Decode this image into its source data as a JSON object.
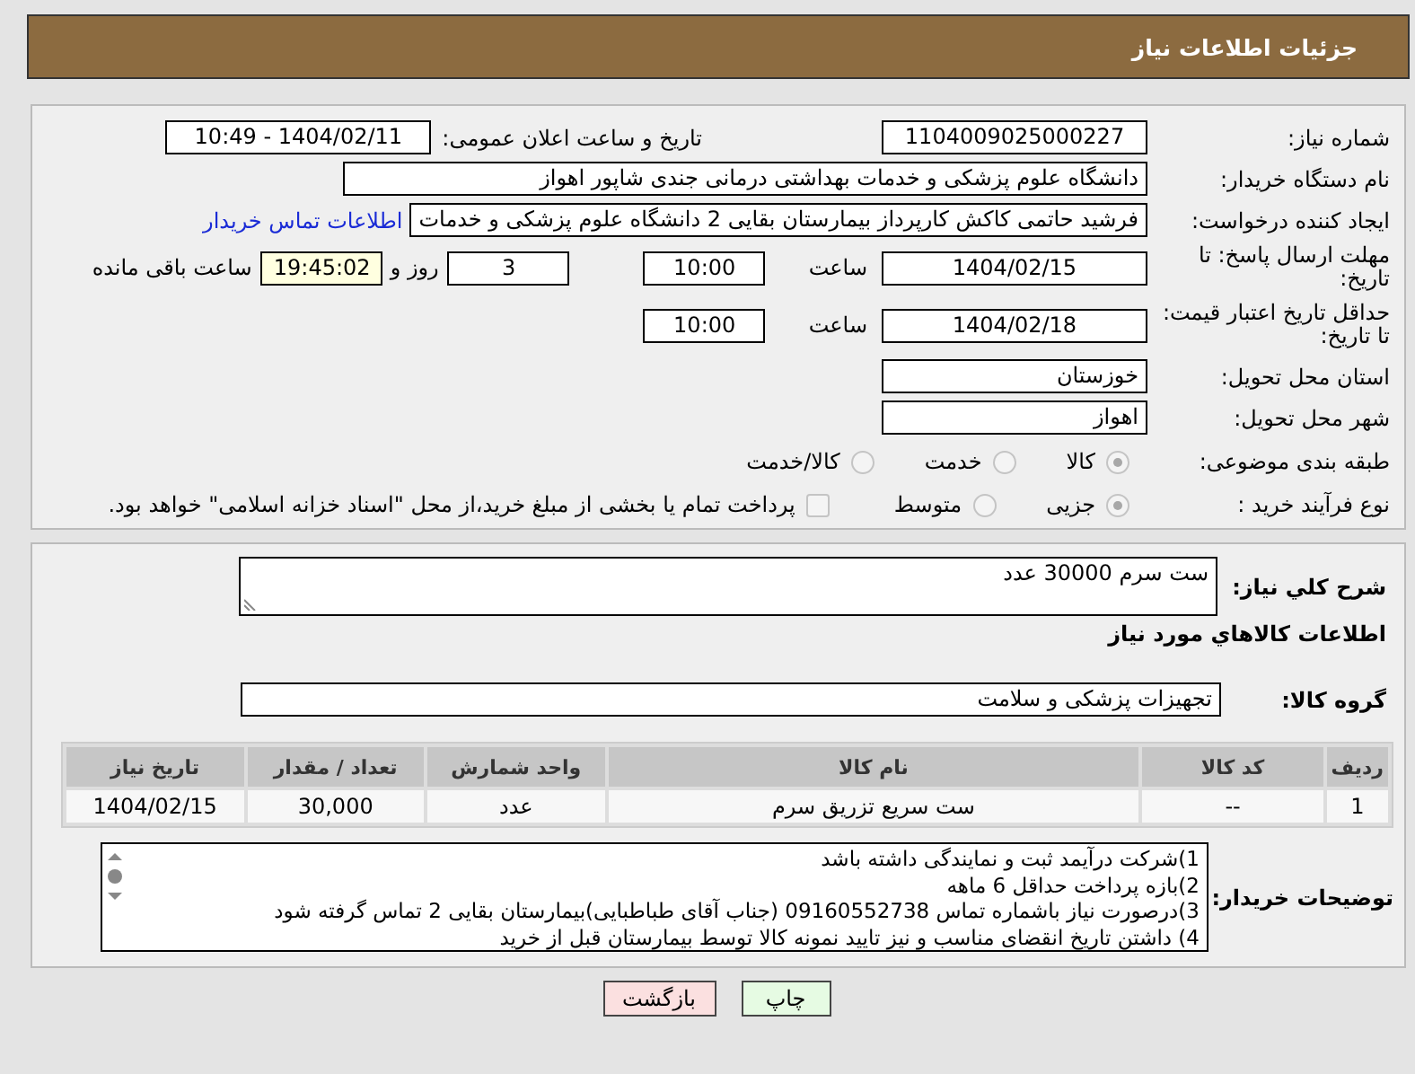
{
  "header": {
    "title": "جزئیات اطلاعات نیاز"
  },
  "details": {
    "need_number": {
      "label": "شماره نیاز:",
      "value": "1104009025000227"
    },
    "announce": {
      "label": "تاریخ و ساعت اعلان عمومی:",
      "value": "1404/02/11 - 10:49"
    },
    "buyer_org": {
      "label": "نام دستگاه خریدار:",
      "value": "دانشگاه علوم پزشکی و خدمات بهداشتی درمانی جندی شاپور اهواز"
    },
    "requester": {
      "label": "ایجاد کننده درخواست:",
      "value": "فرشید حاتمی کاکش کارپرداز بیمارستان بقایی 2 دانشگاه علوم پزشکی و خدمات",
      "link": "اطلاعات تماس خریدار"
    },
    "deadline": {
      "label": "مهلت ارسال پاسخ: تا تاریخ:",
      "date": "1404/02/15",
      "time_label": "ساعت",
      "time": "10:00",
      "days": "3",
      "days_label": "روز و",
      "remaining": "19:45:02",
      "remaining_label": "ساعت باقی مانده"
    },
    "validity": {
      "label": "حداقل تاریخ اعتبار قیمت: تا تاریخ:",
      "date": "1404/02/18",
      "time_label": "ساعت",
      "time": "10:00"
    },
    "province": {
      "label": "استان محل تحویل:",
      "value": "خوزستان"
    },
    "city": {
      "label": "شهر محل تحویل:",
      "value": "اهواز"
    },
    "category": {
      "label": "طبقه بندی موضوعی:",
      "options": [
        {
          "label": "کالا",
          "selected": true
        },
        {
          "label": "خدمت",
          "selected": false
        },
        {
          "label": "کالا/خدمت",
          "selected": false
        }
      ]
    },
    "process": {
      "label": "نوع فرآیند خرید :",
      "options": [
        {
          "label": "جزیی",
          "selected": true
        },
        {
          "label": "متوسط",
          "selected": false
        }
      ],
      "payment": {
        "text": "پرداخت تمام یا بخشی از مبلغ خرید،از محل \"اسناد خزانه اسلامی\" خواهد بود.",
        "checked": false
      }
    }
  },
  "description": {
    "label": "شرح کلي نياز:",
    "value": "ست سرم  30000 عدد"
  },
  "items_title": "اطلاعات کالاهاي مورد نياز",
  "goods_group": {
    "label": "گروه کالا:",
    "value": "تجهیزات پزشکی و سلامت"
  },
  "table": {
    "columns": [
      "ردیف",
      "کد کالا",
      "نام کالا",
      "واحد شمارش",
      "تعداد / مقدار",
      "تاریخ نیاز"
    ],
    "rows": [
      [
        "1",
        "--",
        "ست سریع تزریق سرم",
        "عدد",
        "30,000",
        "1404/02/15"
      ]
    ]
  },
  "buyer_notes": {
    "label": "توضیحات خریدار:",
    "lines": [
      "1)شرکت درآیمد ثبت و نمایندگی داشته باشد",
      "2)بازه پرداخت حداقل 6 ماهه",
      "3)درصورت نیاز باشماره تماس 09160552738 (جناب آقای طباطبایی)بیمارستان بقایی 2 تماس گرفته شود",
      "4) داشتن تاریخ انقضای مناسب و نیز تایید نمونه کالا توسط بیمارستان قبل از خرید"
    ]
  },
  "buttons": [
    {
      "label": "چاپ",
      "kind": "print"
    },
    {
      "label": "بازگشت",
      "kind": "back"
    }
  ]
}
